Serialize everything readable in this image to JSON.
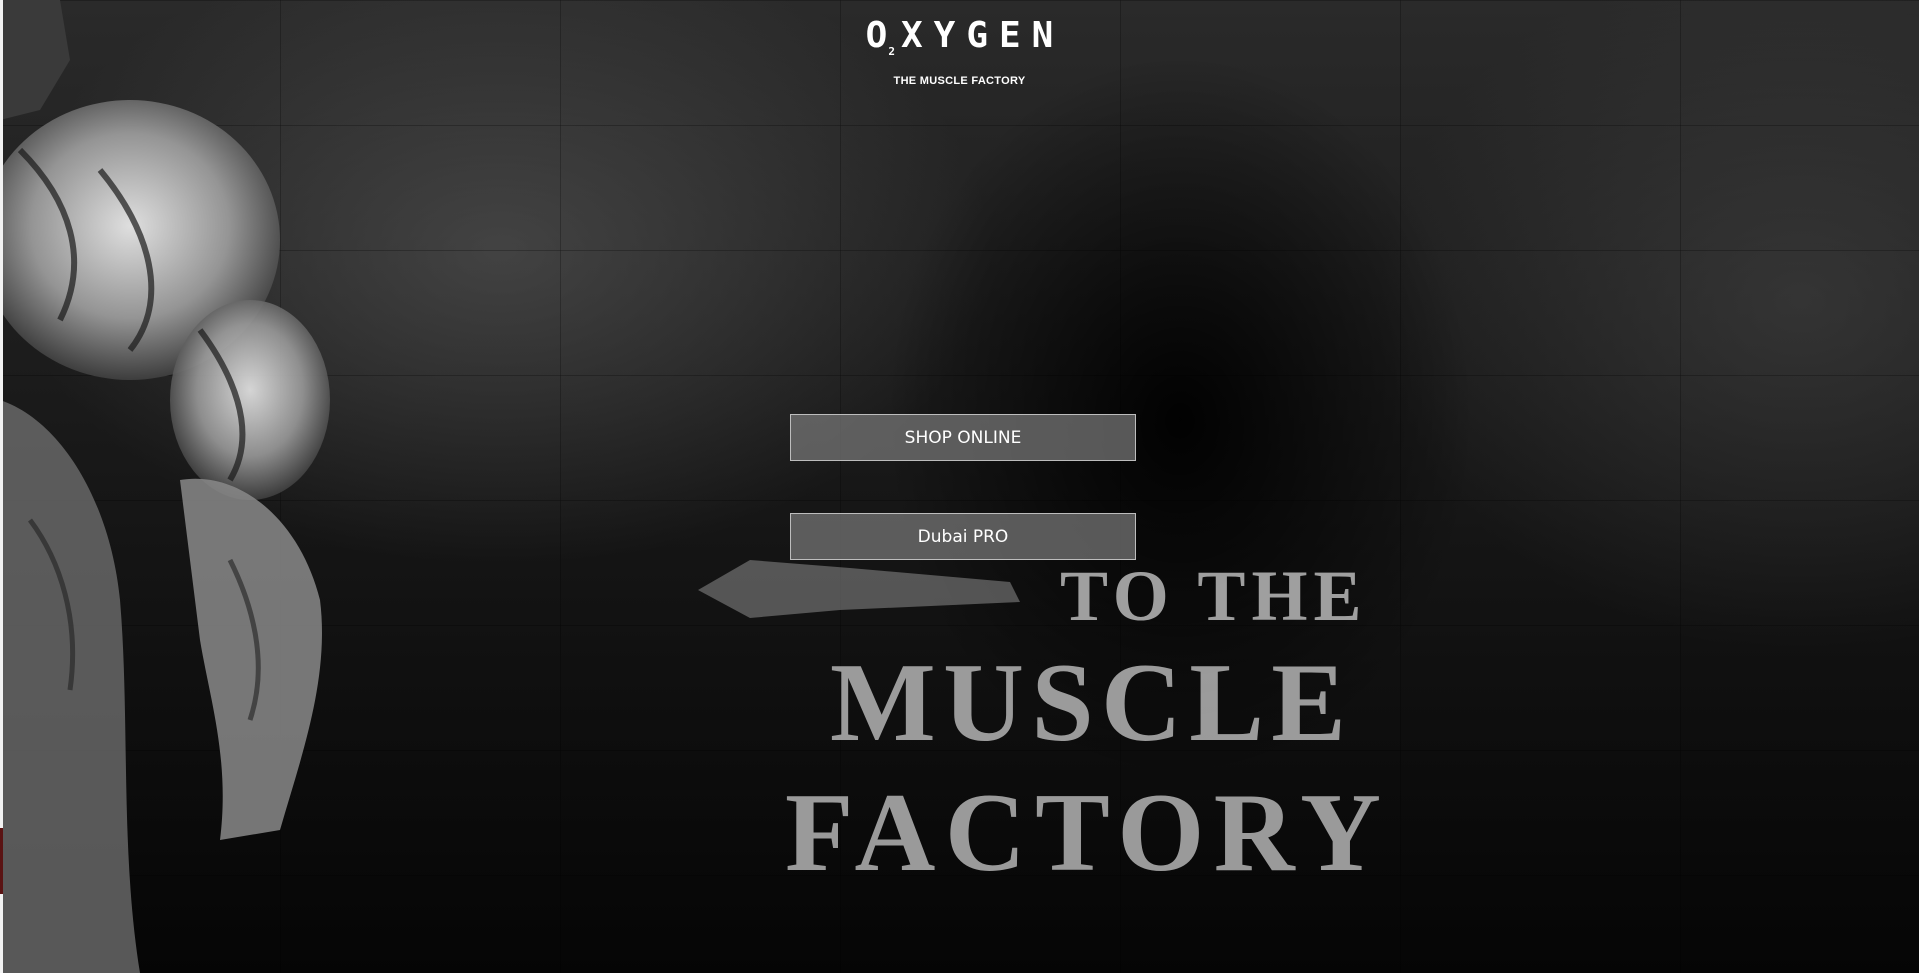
{
  "logo": {
    "wordmark": "OXYGEN",
    "subscript": "2",
    "tagline": "THE MUSCLE FACTORY"
  },
  "hero": {
    "wall_lines": [
      "TO THE",
      "MUSCLE",
      "FACTORY"
    ]
  },
  "buttons": {
    "shop_online": "SHOP ONLINE",
    "dubai_pro": "Dubai PRO"
  },
  "colors": {
    "background": "#000000",
    "button_fill": "#787878",
    "button_border": "#bdbdbd",
    "text": "#ffffff"
  }
}
